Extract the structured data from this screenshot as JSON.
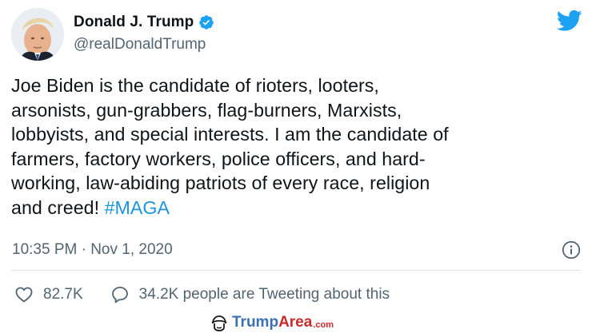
{
  "author": {
    "display_name": "Donald J. Trump",
    "handle": "@realDonaldTrump",
    "verified": true,
    "avatar_icon": "profile-photo",
    "verified_icon": "verified-badge-icon"
  },
  "brand": {
    "icon": "twitter-bird-icon",
    "accent_color": "#1da1f2"
  },
  "tweet": {
    "text": "Joe Biden is the candidate of rioters, looters,\narsonists, gun-grabbers, flag-burners, Marxists,\nlobbyists, and special interests. I am the candidate of\nfarmers, factory workers, police officers, and hard-\nworking, law-abiding patriots of every race, religion\nand creed! ",
    "hashtag": "#MAGA",
    "hashtag_color": "#1b95e0",
    "timestamp": "10:35 PM · Nov 1, 2020"
  },
  "info": {
    "icon": "info-icon"
  },
  "actions": {
    "like_icon": "heart-icon",
    "like_count": "82.7K",
    "reply_icon": "speech-bubble-icon",
    "tweeting_text": "34.2K people are Tweeting about this"
  },
  "watermark": {
    "icon": "trumparea-logo-icon",
    "word1": "Trump",
    "word2": "Area",
    "tld": ".com"
  }
}
